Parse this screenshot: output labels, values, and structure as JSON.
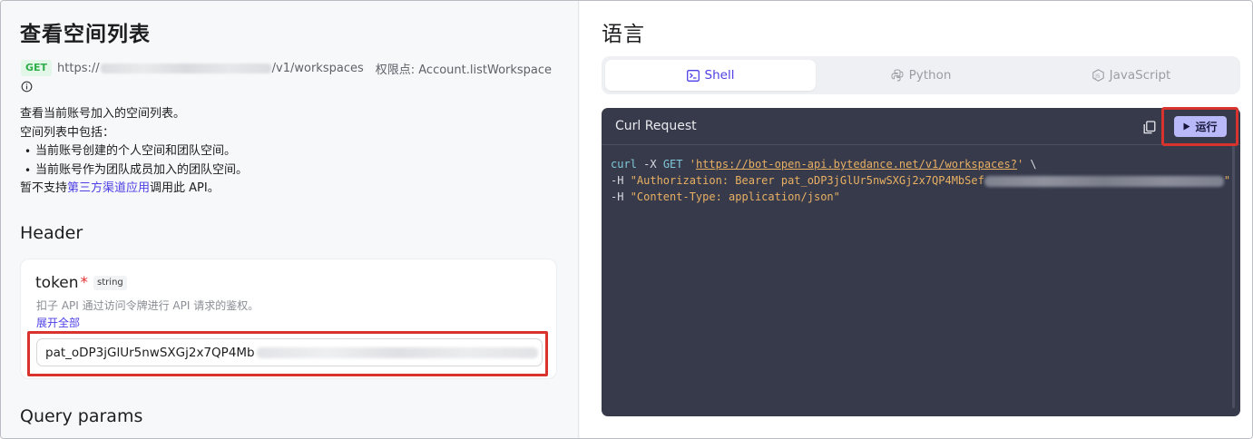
{
  "left": {
    "title": "查看空间列表",
    "endpoint": {
      "method": "GET",
      "url_prefix": "https://",
      "url_suffix": "/v1/workspaces",
      "permission": "权限点: Account.listWorkspace"
    },
    "description": {
      "line1": "查看当前账号加入的空间列表。",
      "line2": "空间列表中包括：",
      "bullets": [
        "当前账号创建的个人空间和团队空间。",
        "当前账号作为团队成员加入的团队空间。"
      ],
      "note_prefix": "暂不支持",
      "note_link": "第三方渠道应用",
      "note_suffix": "调用此 API。"
    },
    "header_section_title": "Header",
    "token_param": {
      "name": "token",
      "required_mark": "*",
      "type": "string",
      "description": "扣子 API 通过访问令牌进行 API 请求的鉴权。",
      "expand_label": "展开全部",
      "value": "pat_oDP3jGlUr5nwSXGj2x7QP4Mb"
    },
    "query_section_title": "Query params"
  },
  "right": {
    "title": "语言",
    "tabs": [
      {
        "label": "Shell",
        "icon": "terminal-icon",
        "active": true
      },
      {
        "label": "Python",
        "icon": "python-icon",
        "active": false
      },
      {
        "label": "JavaScript",
        "icon": "nodejs-icon",
        "active": false
      }
    ],
    "code_panel": {
      "title": "Curl Request",
      "run_label": "运行",
      "lines": {
        "l1_cmd": "curl",
        "l1_flag": " -X ",
        "l1_method": "GET",
        "l1_url_open": " '",
        "l1_url": "https://bot-open-api.bytedance.net/v1/workspaces?",
        "l1_url_close": "'",
        "l1_cont": " \\",
        "l2_flag": "-H ",
        "l2_str": "\"Authorization: Bearer pat_oDP3jGlUr5nwSXGj2x7QP4MbSef",
        "l2_close": "\"",
        "l3_flag": "-H ",
        "l3_str": "\"Content-Type: application/json\""
      }
    }
  },
  "colors": {
    "accent": "#4e40e5",
    "highlight_box": "#d8332c",
    "code_bg": "#363a4b",
    "get_badge": "#2fae4b"
  }
}
